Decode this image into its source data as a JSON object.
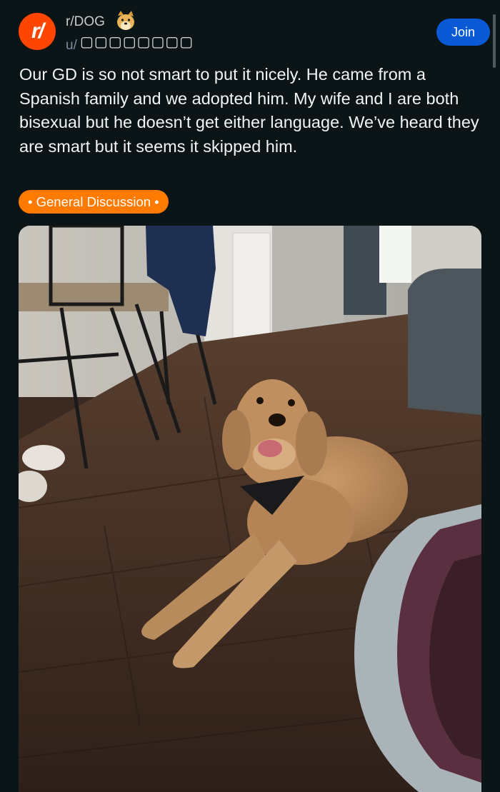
{
  "post": {
    "subreddit": "r/DOG",
    "user_prefix": "u/",
    "username": "▢▢▢▢▢▢▢▢",
    "join_label": "Join",
    "body": "Our GD is so not smart to put it nicely. He came from a Spanish family and we adopted him. My wife and I are both bisexual but he doesn’t get either language. We’ve heard they are smart but it seems it skipped him.",
    "flair": "• General Discussion •"
  },
  "colors": {
    "background": "#0b1416",
    "accent": "#ff4500",
    "join": "#0a5ad6",
    "flair": "#ff7a00"
  },
  "icons": {
    "subreddit_avatar": "reddit-r-icon",
    "subreddit_badge": "doge-icon"
  }
}
